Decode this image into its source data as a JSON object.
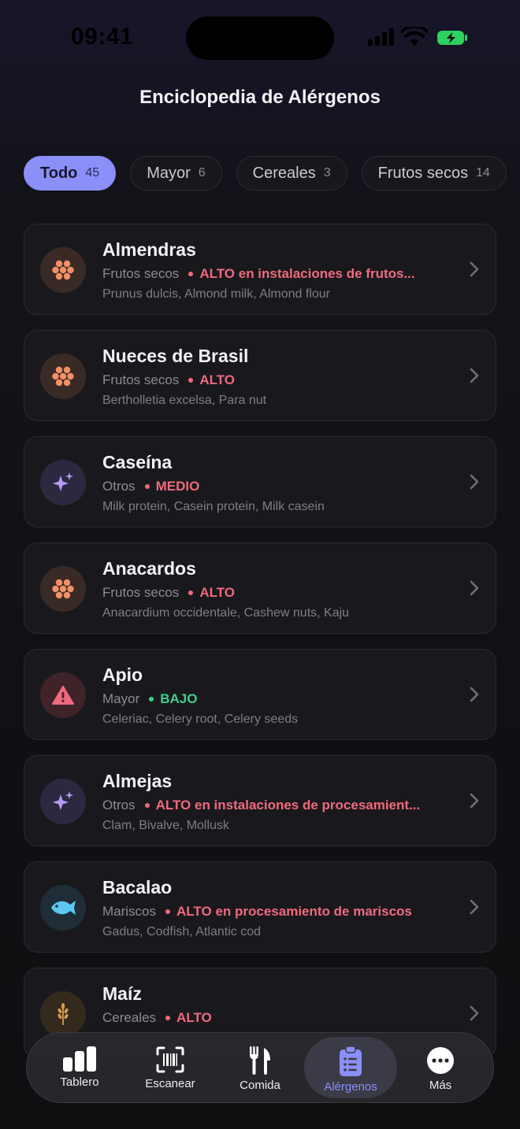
{
  "status_bar": {
    "time": "09:41"
  },
  "header": {
    "title": "Enciclopedia de Alérgenos"
  },
  "filters": [
    {
      "label": "Todo",
      "count": "45",
      "active": true
    },
    {
      "label": "Mayor",
      "count": "6",
      "active": false
    },
    {
      "label": "Cereales",
      "count": "3",
      "active": false
    },
    {
      "label": "Frutos secos",
      "count": "14",
      "active": false
    }
  ],
  "colors": {
    "accent": "#8b8ff8",
    "risk_high": "#f06a7e",
    "risk_low": "#3fd08e"
  },
  "items": [
    {
      "name": "Almendras",
      "category": "Frutos secos",
      "risk": "ALTO en instalaciones de frutos...",
      "risk_level": "high",
      "aliases": "Prunus dulcis, Almond milk, Almond flour",
      "icon": "nut-cluster-icon"
    },
    {
      "name": "Nueces de Brasil",
      "category": "Frutos secos",
      "risk": "ALTO",
      "risk_level": "high",
      "aliases": "Bertholletia excelsa, Para nut",
      "icon": "nut-cluster-icon"
    },
    {
      "name": "Caseína",
      "category": "Otros",
      "risk": "MEDIO",
      "risk_level": "high",
      "aliases": "Milk protein, Casein protein, Milk casein",
      "icon": "sparkles-icon"
    },
    {
      "name": "Anacardos",
      "category": "Frutos secos",
      "risk": "ALTO",
      "risk_level": "high",
      "aliases": "Anacardium occidentale, Cashew nuts, Kaju",
      "icon": "nut-cluster-icon"
    },
    {
      "name": "Apio",
      "category": "Mayor",
      "risk": "BAJO",
      "risk_level": "low",
      "aliases": "Celeriac, Celery root, Celery seeds",
      "icon": "warning-triangle-icon"
    },
    {
      "name": "Almejas",
      "category": "Otros",
      "risk": "ALTO en instalaciones de procesamient...",
      "risk_level": "high",
      "aliases": "Clam, Bivalve, Mollusk",
      "icon": "sparkles-icon"
    },
    {
      "name": "Bacalao",
      "category": "Mariscos",
      "risk": "ALTO en procesamiento de mariscos",
      "risk_level": "high",
      "aliases": "Gadus, Codfish, Atlantic cod",
      "icon": "fish-icon"
    },
    {
      "name": "Maíz",
      "category": "Cereales",
      "risk": "ALTO",
      "risk_level": "high",
      "aliases": "",
      "icon": "wheat-icon"
    }
  ],
  "tabbar": [
    {
      "label": "Tablero",
      "icon": "bar-chart-icon",
      "active": false
    },
    {
      "label": "Escanear",
      "icon": "barcode-scan-icon",
      "active": false
    },
    {
      "label": "Comida",
      "icon": "fork-knife-icon",
      "active": false
    },
    {
      "label": "Alérgenos",
      "icon": "clipboard-list-icon",
      "active": true
    },
    {
      "label": "Más",
      "icon": "more-dots-icon",
      "active": false
    }
  ]
}
